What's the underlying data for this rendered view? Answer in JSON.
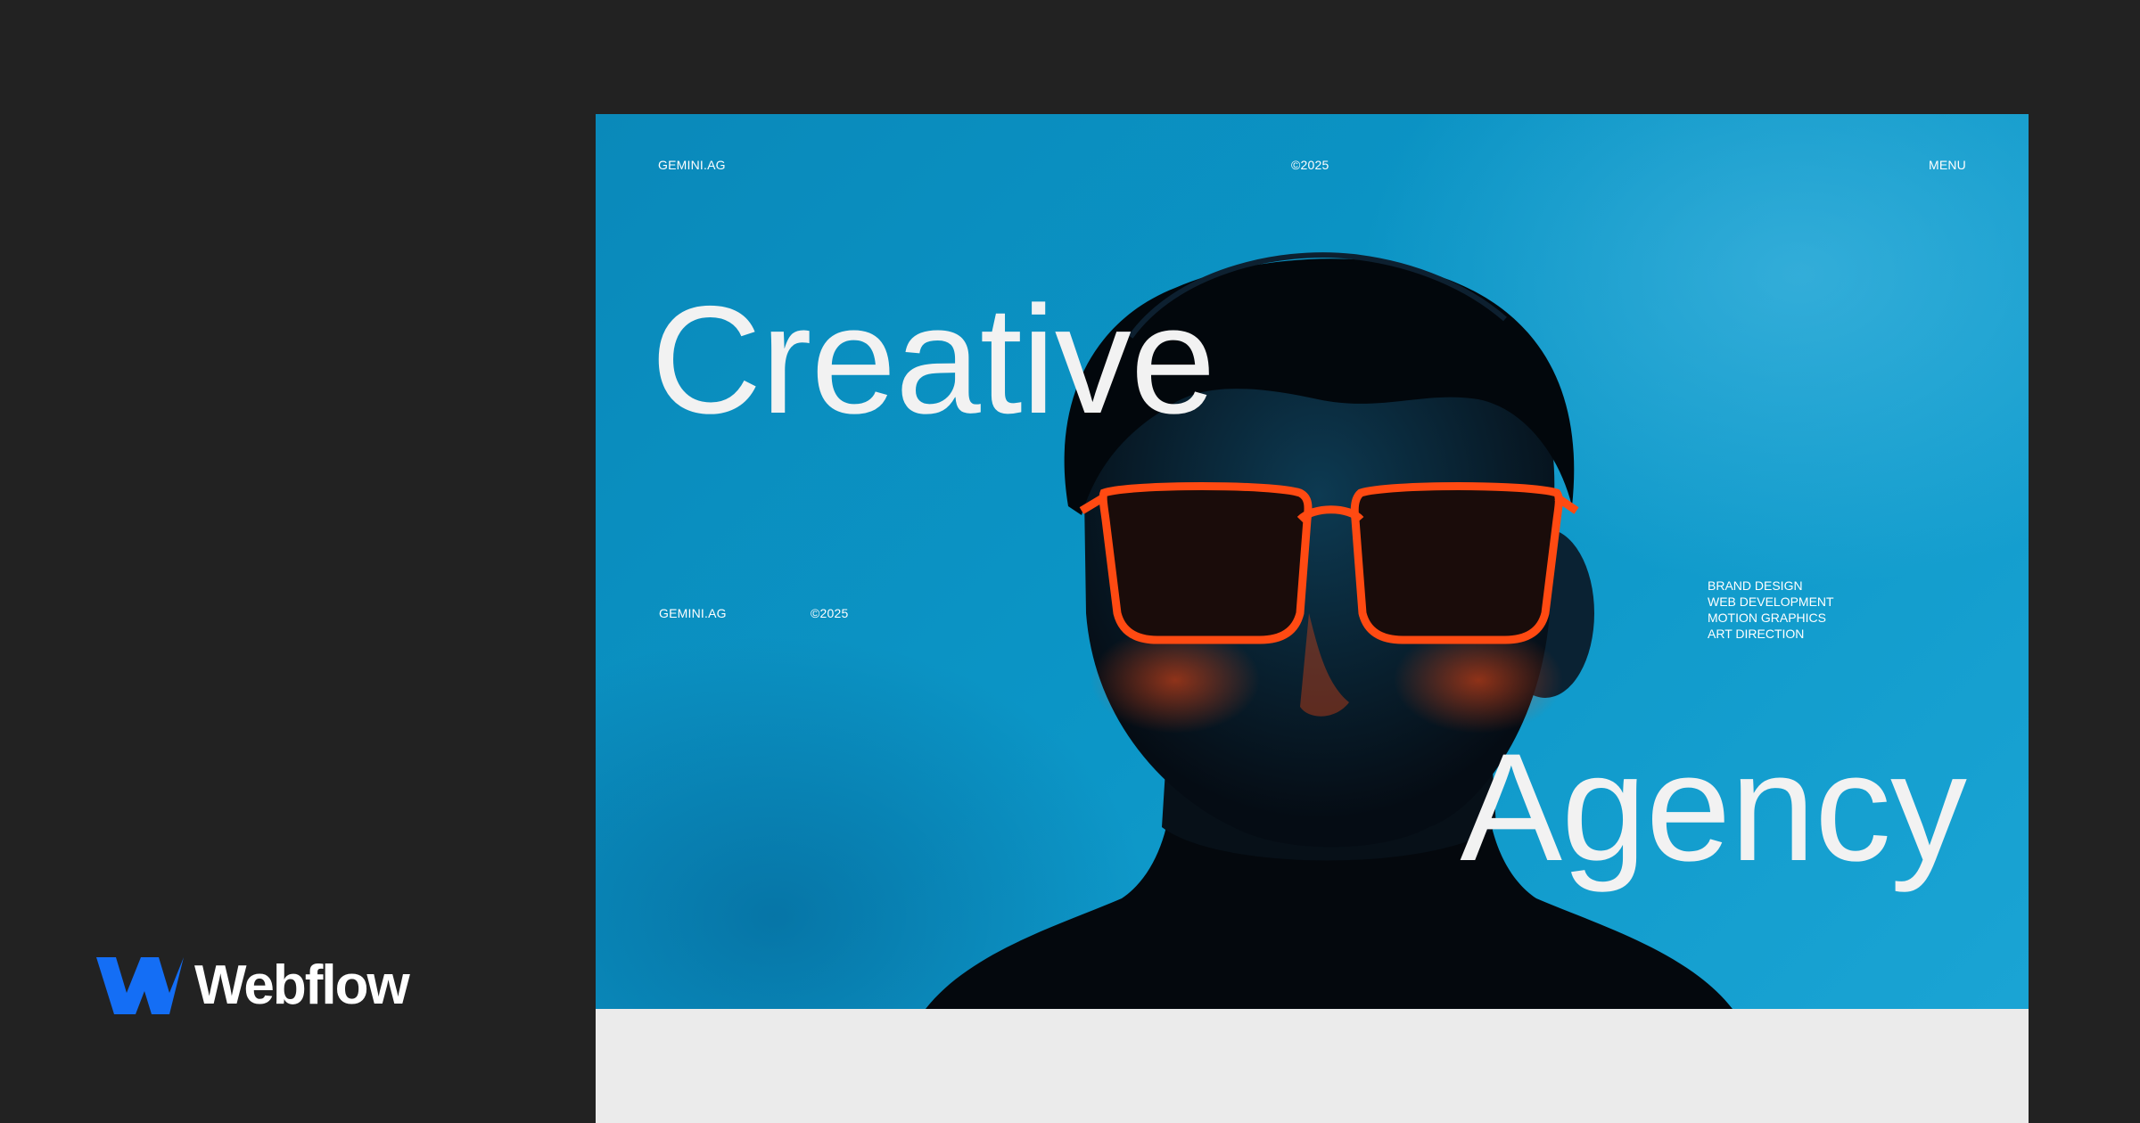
{
  "brand": {
    "name": "Webflow",
    "logo_icon": "webflow-w-logo",
    "logo_color": "#146ef5"
  },
  "hero": {
    "nav": {
      "brand": "GEMINI.AG",
      "year": "©2025",
      "menu": "MENU"
    },
    "headline_line1": "Creative",
    "headline_line2": "Agency",
    "meta": {
      "brand": "GEMINI.AG",
      "year": "©2025"
    },
    "services": [
      "BRAND DESIGN",
      "WEB DEVELOPMENT",
      "MOTION GRAPHICS",
      "ART DIRECTION"
    ],
    "background_color": "#0b8fc0",
    "glasses_color": "#ff4a12"
  }
}
